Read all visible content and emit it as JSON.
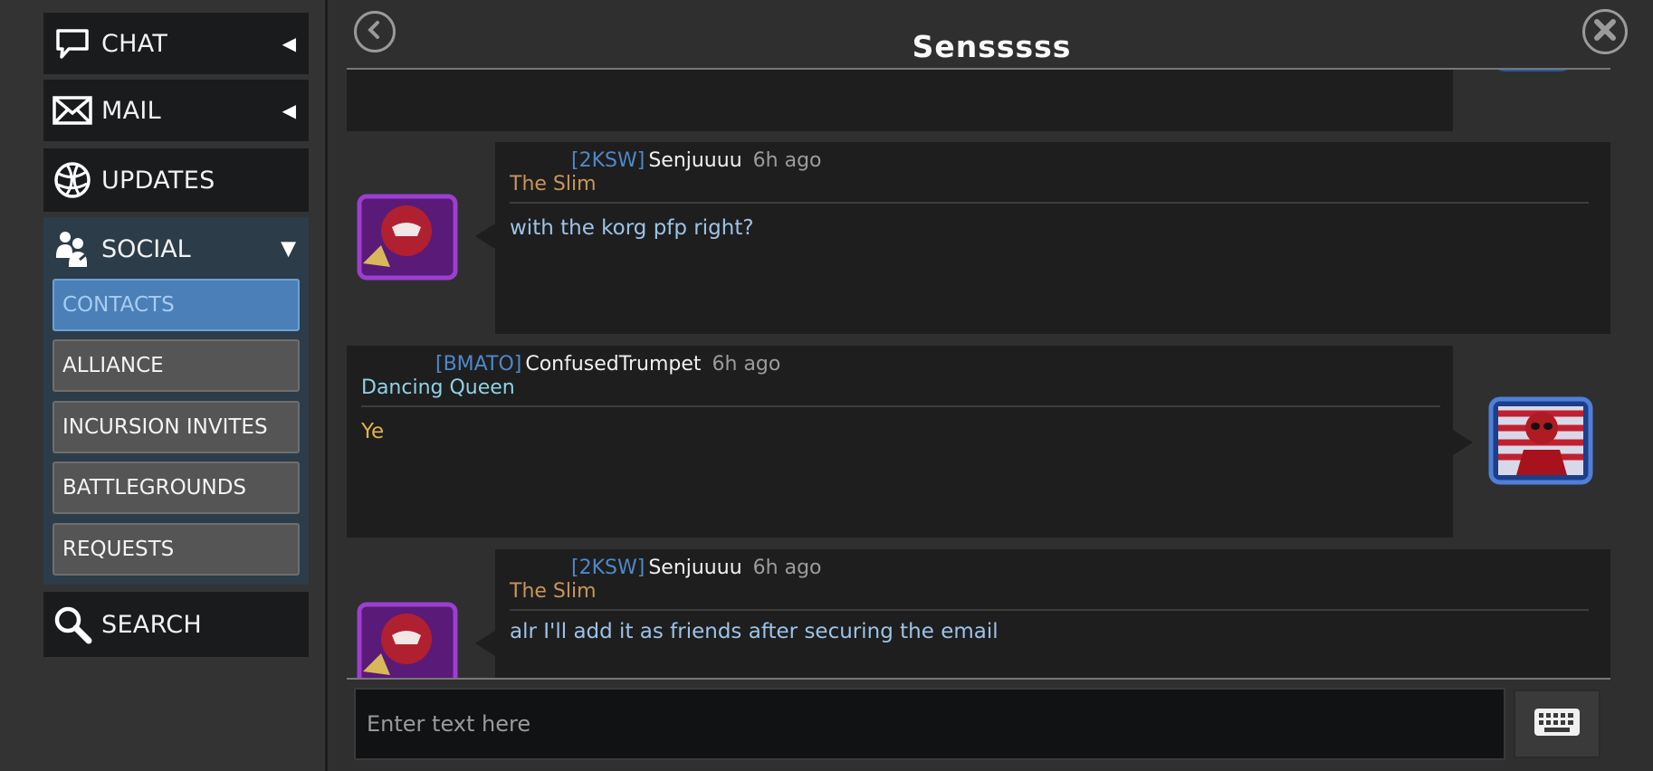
{
  "sidebar": {
    "chat_label": "CHAT",
    "mail_label": "MAIL",
    "updates_label": "UPDATES",
    "social_label": "SOCIAL",
    "social_items": [
      "CONTACTS",
      "ALLIANCE",
      "INCURSION INVITES",
      "BATTLEGROUNDS",
      "REQUESTS"
    ],
    "search_label": "SEARCH",
    "collapsed_arrow": "◀",
    "expanded_arrow": "▼"
  },
  "header": {
    "title": "Sensssss"
  },
  "messages": [
    {
      "alliance_tag": "[2KSW]",
      "username": "Senjuuuu",
      "time": "6h ago",
      "title": "The Slim",
      "text": "with the korg pfp right?",
      "side": "left",
      "title_color": "#c8955a",
      "text_color": "#9cc3e8"
    },
    {
      "alliance_tag": "[BMATO]",
      "username": "ConfusedTrumpet",
      "time": "6h ago",
      "title": "Dancing Queen",
      "text": "Ye",
      "side": "right",
      "title_color": "#8fd3e6",
      "text_color": "#e0b44a"
    },
    {
      "alliance_tag": "[2KSW]",
      "username": "Senjuuuu",
      "time": "6h ago",
      "title": "The Slim",
      "text": "alr I'll add it as friends after securing the email",
      "side": "left",
      "title_color": "#c8955a",
      "text_color": "#9cc3e8"
    }
  ],
  "input": {
    "placeholder": "Enter text here"
  },
  "colors": {
    "active_tab": "#4a7fb8",
    "tag": "#4f88c8"
  },
  "icons": {
    "chat": "speech-bubble-icon",
    "mail": "envelope-icon",
    "updates": "globe-icon",
    "social": "people-icon",
    "search": "magnifier-icon",
    "back": "chevron-left-icon",
    "close": "close-icon",
    "keyboard": "keyboard-icon"
  }
}
